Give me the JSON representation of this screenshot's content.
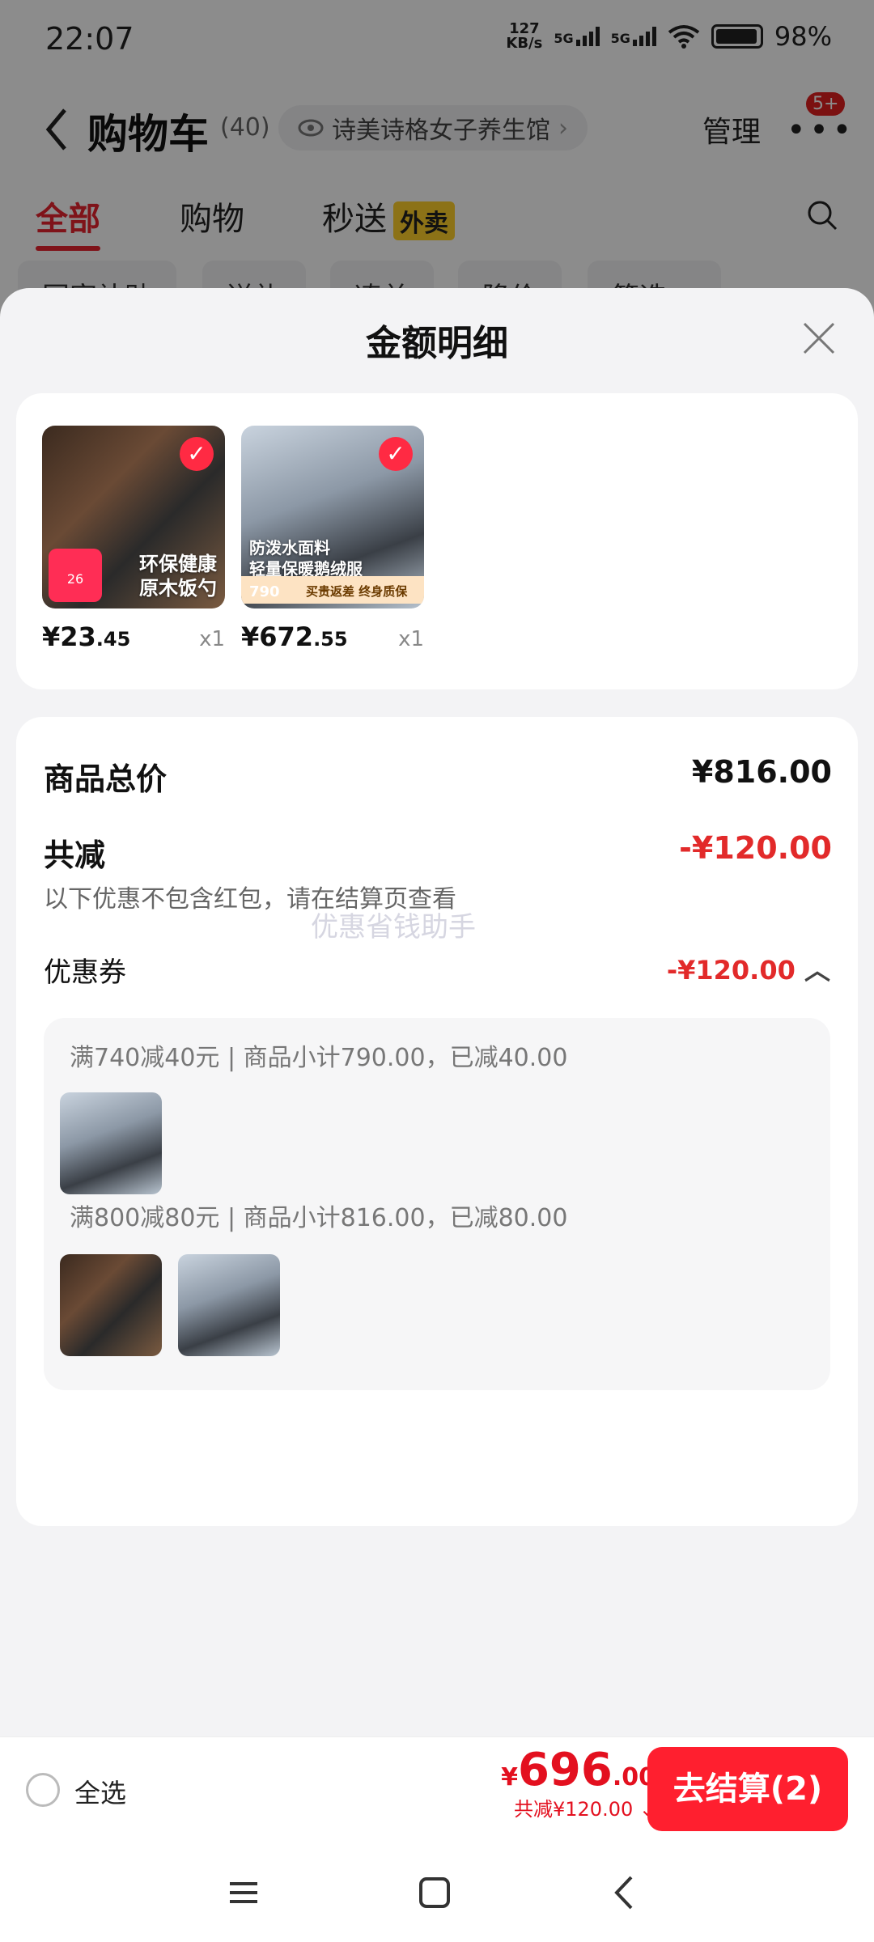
{
  "status": {
    "time": "22:07",
    "net_speed_top": "127",
    "net_speed_bottom": "KB/s",
    "signal1": "5G",
    "signal2": "5G",
    "battery": "98%"
  },
  "header": {
    "back_icon": "chevron-left-icon",
    "title": "购物车",
    "count": "(40)",
    "shop": "诗美诗格女子养生馆",
    "manage": "管理",
    "more_icon": "more-dots-icon",
    "badge": "5+"
  },
  "tabs": [
    {
      "label": "全部",
      "active": true
    },
    {
      "label": "购物"
    },
    {
      "label": "秒送",
      "tag": "外卖"
    }
  ],
  "chips": [
    "国家补贴",
    "送礼",
    "凑单",
    "降价",
    "筛选 ▽"
  ],
  "sheet": {
    "title": "金额明细",
    "close_icon": "close-icon",
    "products": [
      {
        "price_main": "¥23",
        "price_dec": ".45",
        "qty": "x1",
        "image_text": "环保健康\n原木饭勺",
        "badge_num": "26"
      },
      {
        "price_main": "¥672",
        "price_dec": ".55",
        "qty": "x1",
        "image_text": "防泼水面料\n轻量保暖鹅绒服",
        "price_tag": "790",
        "band": "买贵返差 终身质保"
      }
    ],
    "total_label": "商品总价",
    "total_value": "¥816.00",
    "reduce_label": "共减",
    "reduce_value": "-¥120.00",
    "reduce_note": "以下优惠不包含红包，请在结算页查看",
    "watermark": "优惠省钱助手",
    "coupon_label": "优惠券",
    "coupon_value": "-¥120.00",
    "coupon_lines": [
      "满740减40元 | 商品小计790.00，已减40.00",
      "满800减80元 | 商品小计816.00，已减80.00"
    ]
  },
  "bottom": {
    "select_all": "全选",
    "currency": "¥",
    "total_int": "696",
    "total_dec": ".00",
    "discount": "共减¥120.00",
    "checkout": "去结算(2)"
  },
  "colors": {
    "accent": "#e8232f",
    "checkout": "#ff1f2f",
    "discount": "#e22a2a"
  }
}
